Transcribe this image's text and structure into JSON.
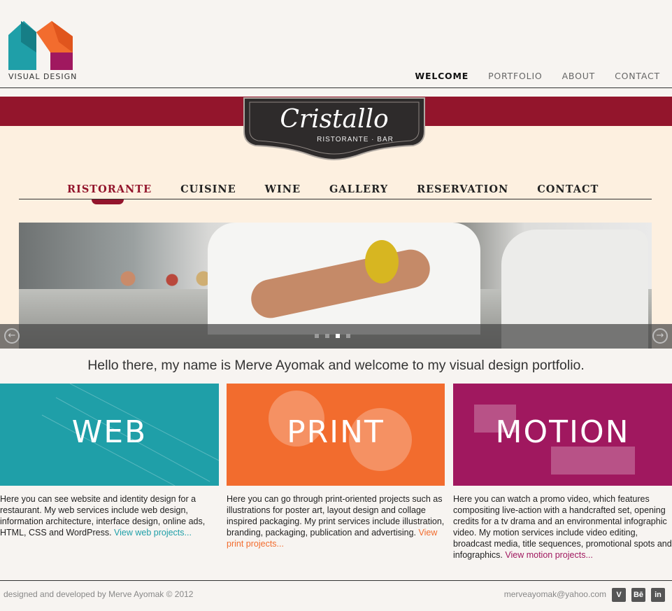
{
  "brand": {
    "logo_text": "VISUAL DESIGN"
  },
  "topnav": {
    "items": [
      "WELCOME",
      "PORTFOLIO",
      "ABOUT",
      "CONTACT"
    ],
    "active": "WELCOME"
  },
  "hero": {
    "badge_title": "Cristallo",
    "badge_subtitle": "RISTORANTE · BAR",
    "restaurant_nav": [
      "RISTORANTE",
      "CUISINE",
      "WINE",
      "GALLERY",
      "RESERVATION",
      "CONTACT"
    ],
    "slider": {
      "dots": 4,
      "active_index": 2
    }
  },
  "intro": "Hello there, my name is Merve Ayomak and welcome to my visual design portfolio.",
  "tiles": [
    {
      "label": "WEB",
      "color": "#1f9fa8",
      "description": "Here you can see website and identity design for a restaurant. My web services include web design, information architecture, interface design, online ads, HTML, CSS and WordPress. ",
      "link": "View web projects..."
    },
    {
      "label": "PRINT",
      "color": "#f26c2e",
      "description": "Here you can go through print-oriented projects such as illustrations for poster art, layout design and collage inspired packaging. My print services include illustration, branding, packaging, publication and advertising. ",
      "link": "View print projects..."
    },
    {
      "label": "MOTION",
      "color": "#a0185f",
      "description": "Here you can watch a promo video, which features compositing live-action with a handcrafted set, opening credits for a tv drama and an environmental infographic video. My motion services include video editing, broadcast media, title sequences, promotional spots and infographics. ",
      "link": "View motion projects..."
    }
  ],
  "footer": {
    "credit": "designed and developed by Merve Ayomak © 2012",
    "email": "merveayomak@yahoo.com",
    "social": [
      {
        "icon": "vimeo-icon",
        "glyph": "V"
      },
      {
        "icon": "behance-icon",
        "glyph": "Bē"
      },
      {
        "icon": "linkedin-icon",
        "glyph": "in"
      }
    ]
  }
}
